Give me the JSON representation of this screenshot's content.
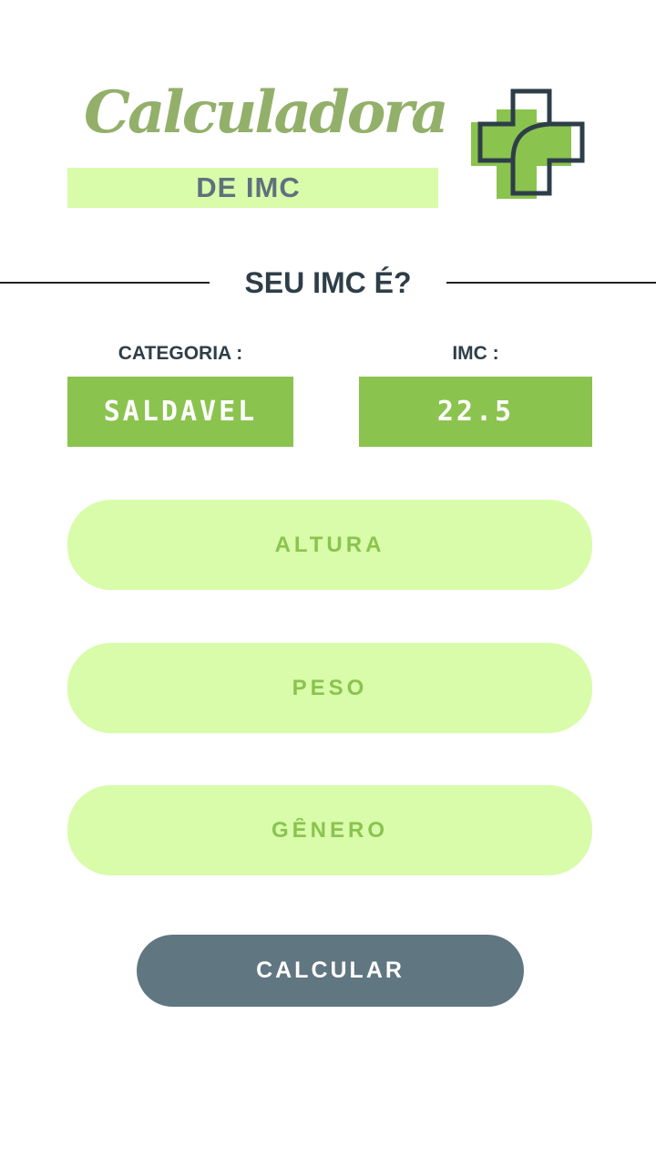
{
  "header": {
    "title": "Calculadora",
    "subtitle": "DE IMC",
    "logo_icon": "medical-cross-icon"
  },
  "result_section": {
    "heading": "SEU IMC É?",
    "category_label": "CATEGORIA :",
    "category_value": "SALDAVEL",
    "imc_label": "IMC :",
    "imc_value": "22.5"
  },
  "form": {
    "height_placeholder": "ALTURA",
    "height_value": "",
    "weight_placeholder": "PESO",
    "weight_value": "",
    "gender_placeholder": "GÊNERO",
    "gender_value": ""
  },
  "actions": {
    "calculate_label": "CALCULAR"
  },
  "colors": {
    "title_green": "#93b06a",
    "light_green": "#d8fcaa",
    "result_green": "#8bc34f",
    "slate": "#607681",
    "dark_text": "#2e3e48"
  }
}
